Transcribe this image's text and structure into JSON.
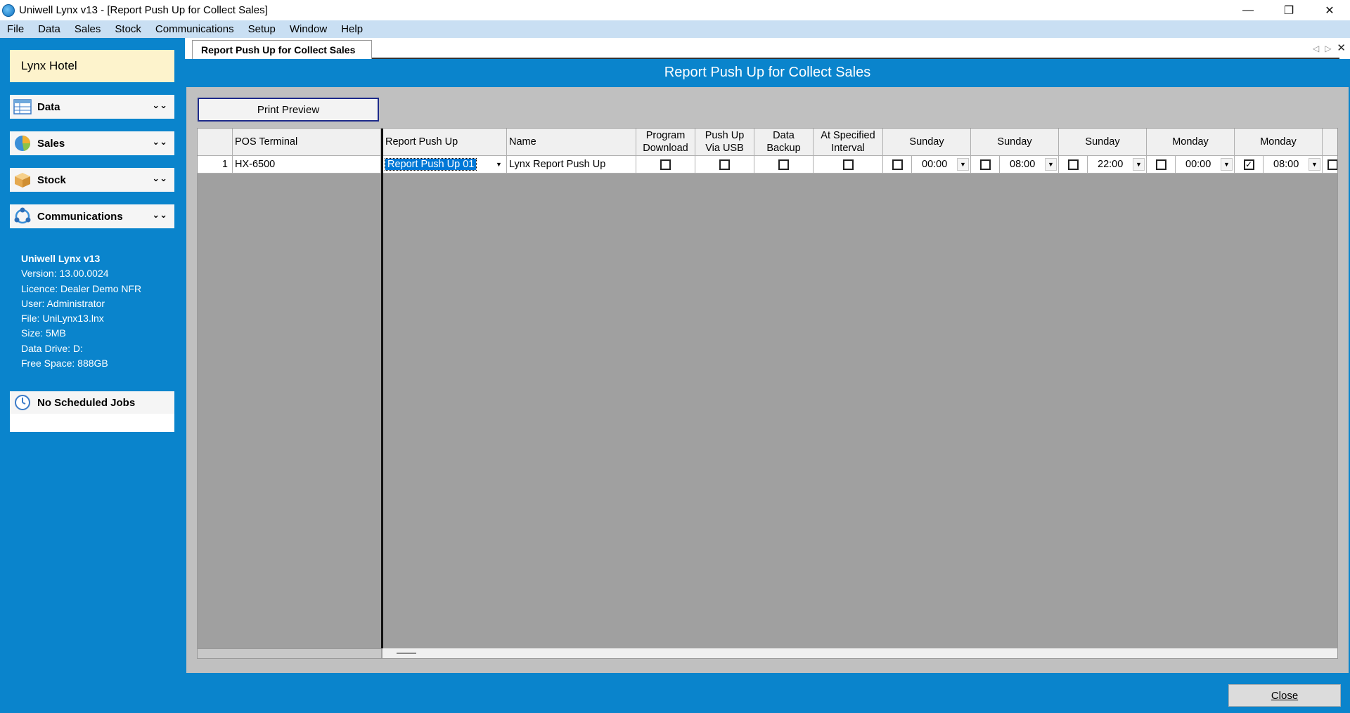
{
  "window": {
    "title": "Uniwell Lynx v13 - [Report Push Up for Collect Sales]",
    "controls": [
      "—",
      "❐",
      "✕"
    ]
  },
  "menu": [
    "File",
    "Data",
    "Sales",
    "Stock",
    "Communications",
    "Setup",
    "Window",
    "Help"
  ],
  "sidebar": {
    "hotel_name": "Lynx Hotel",
    "items": [
      {
        "label": "Data",
        "icon": "data-table-icon"
      },
      {
        "label": "Sales",
        "icon": "pie-chart-icon"
      },
      {
        "label": "Stock",
        "icon": "box-icon"
      },
      {
        "label": "Communications",
        "icon": "network-icon"
      }
    ],
    "info": {
      "product": "Uniwell Lynx v13",
      "version": "Version: 13.00.0024",
      "licence": "Licence: Dealer Demo NFR",
      "user": "User: Administrator",
      "file": "File: UniLynx13.lnx",
      "size": "Size: 5MB",
      "data_drive": "Data Drive: D:",
      "free_space": "Free Space: 888GB"
    },
    "jobs_label": "No Scheduled Jobs"
  },
  "tab": {
    "label": "Report Push Up for Collect Sales"
  },
  "main": {
    "title": "Report Push Up for Collect Sales",
    "print_preview": "Print Preview",
    "close": "Close"
  },
  "grid": {
    "headers": {
      "pos_terminal": "POS Terminal",
      "report_push_up": "Report Push Up",
      "name": "Name",
      "program_download_1": "Program",
      "program_download_2": "Download",
      "push_usb_1": "Push Up",
      "push_usb_2": "Via USB",
      "data_backup_1": "Data",
      "data_backup_2": "Backup",
      "interval_1": "At Specified",
      "interval_2": "Interval",
      "day1": "Sunday",
      "day2": "Sunday",
      "day3": "Sunday",
      "day4": "Monday",
      "day5": "Monday"
    },
    "row": {
      "num": "1",
      "pos_terminal": "HX-6500",
      "report_push_up": "Report Push Up 01",
      "name": "Lynx Report Push Up",
      "program_download": false,
      "push_usb": false,
      "data_backup": false,
      "interval": false,
      "slots": [
        {
          "checked": false,
          "time": "00:00"
        },
        {
          "checked": false,
          "time": "08:00"
        },
        {
          "checked": false,
          "time": "22:00"
        },
        {
          "checked": false,
          "time": "00:00"
        },
        {
          "checked": true,
          "time": "08:00"
        }
      ]
    }
  },
  "colors": {
    "brand_blue": "#0a84cc",
    "menubar": "#c9dff3",
    "hotel_bg": "#fdf3cc",
    "selection": "#0078d7"
  }
}
